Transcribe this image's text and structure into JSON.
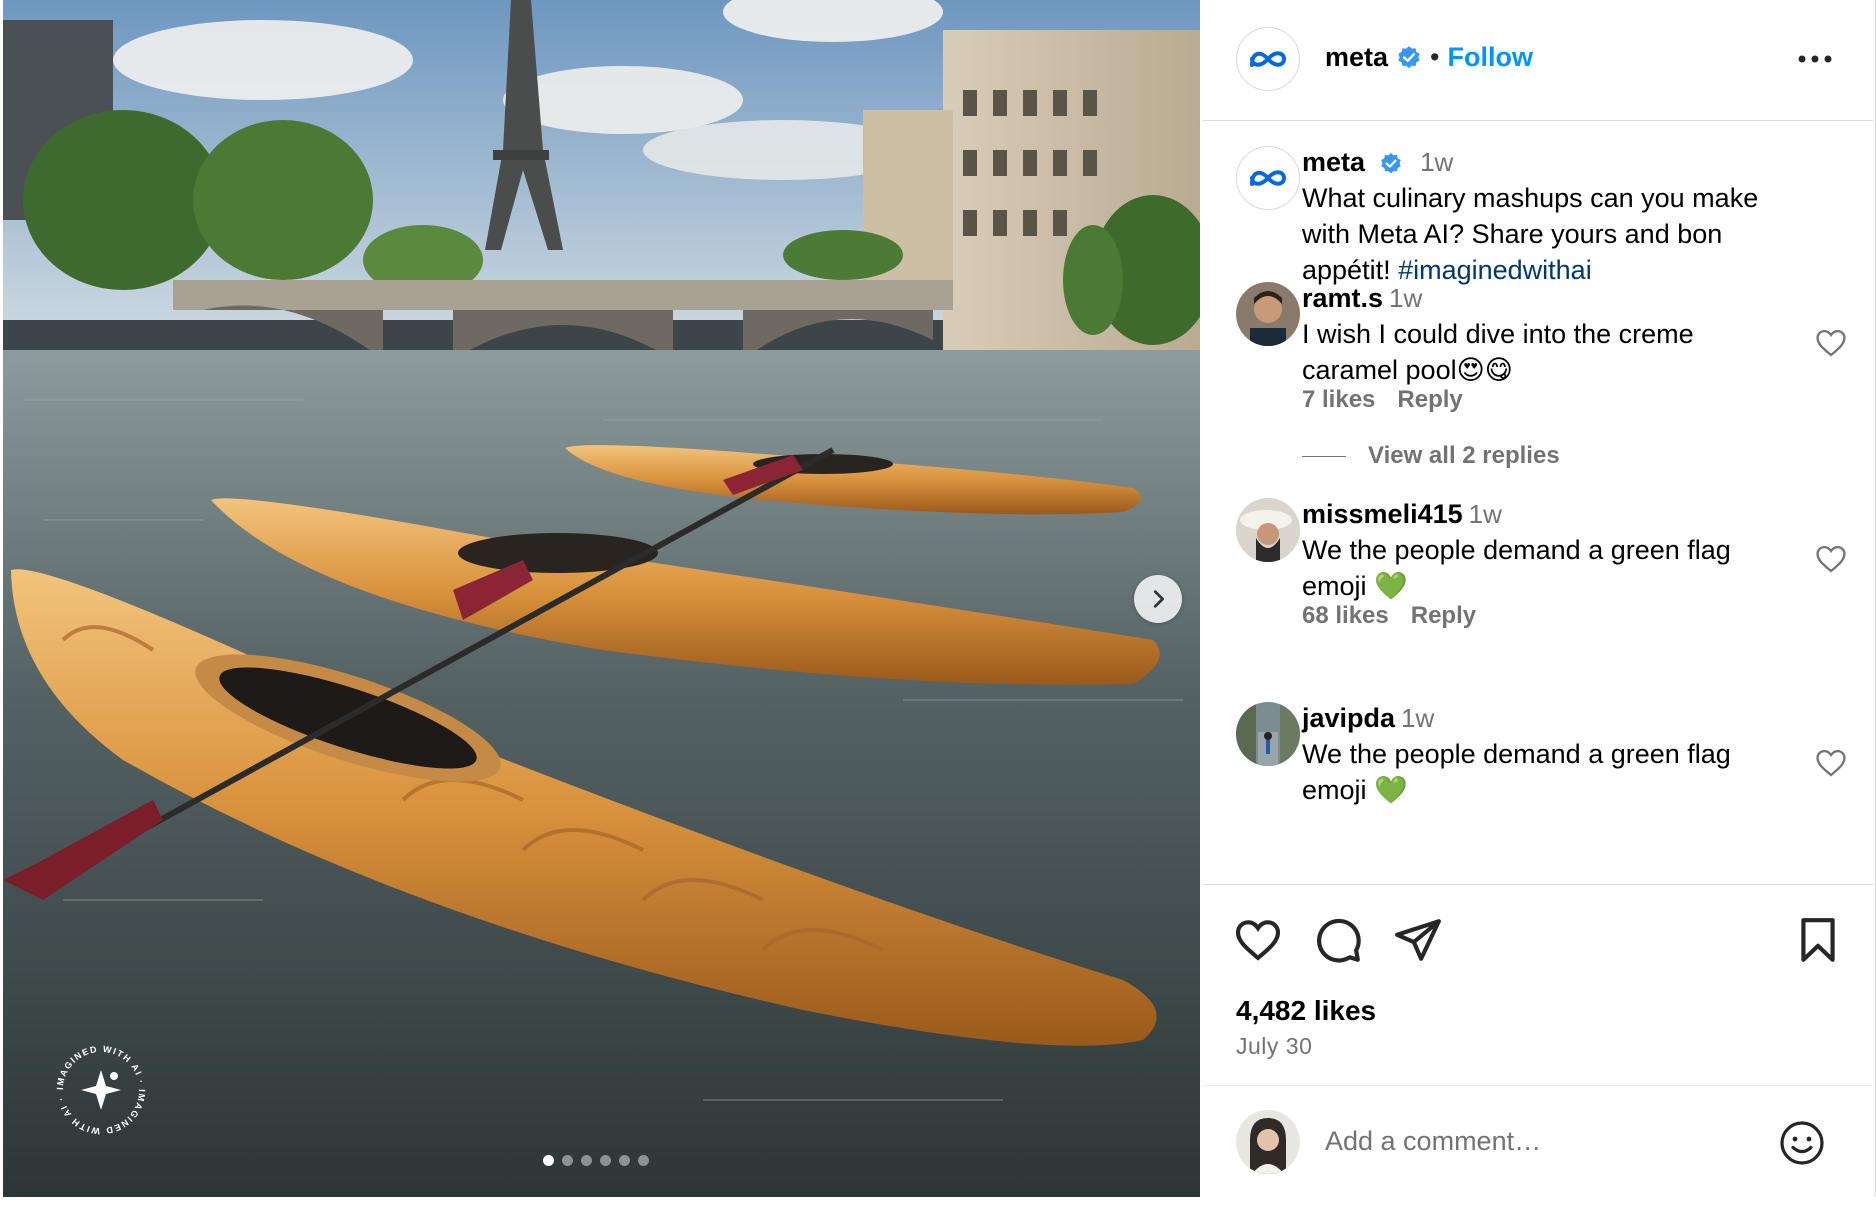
{
  "post": {
    "author": "meta",
    "follow_label": "Follow",
    "separator": "•",
    "caption": {
      "username": "meta",
      "time": "1w",
      "text": "What culinary mashups can you make with Meta AI? Share yours and bon appétit! ",
      "hashtag": "#imaginedwithai"
    },
    "carousel": {
      "total": 6,
      "active_index": 0
    },
    "watermark": "IMAGINED WITH AI · IMAGINED WITH AI ·",
    "likes": "4,482 likes",
    "date": "July 30"
  },
  "comments": [
    {
      "username": "ramt.s",
      "time": "1w",
      "text": "I wish I could dive into the creme caramel pool😍😋",
      "likes": "7 likes",
      "reply_label": "Reply",
      "view_replies": "View all 2 replies"
    },
    {
      "username": "missmeli415",
      "time": "1w",
      "text": "We the people demand a green flag emoji 💚",
      "likes": "68 likes",
      "reply_label": "Reply"
    },
    {
      "username": "javipda",
      "time": "1w",
      "text": "We the people demand a green flag emoji 💚"
    }
  ],
  "composer": {
    "placeholder": "Add a comment…"
  },
  "colors": {
    "follow": "#0095f6",
    "verified": "#3897f0",
    "meta_gradient_start": "#0064e0",
    "meta_gradient_end": "#0082fb"
  },
  "icons": [
    "meta-logo-icon",
    "verified-icon",
    "more-icon",
    "heart-icon",
    "comment-icon",
    "share-icon",
    "bookmark-icon",
    "emoji-icon",
    "chevron-right-icon"
  ]
}
